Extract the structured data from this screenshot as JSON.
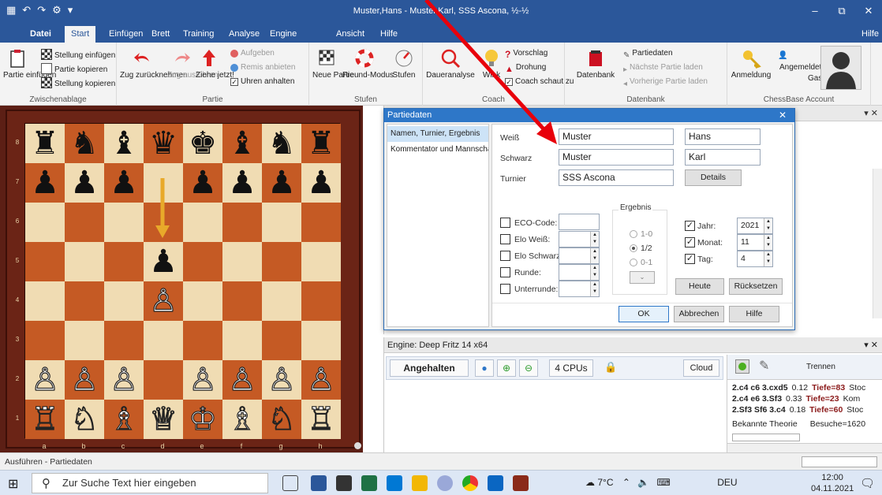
{
  "window": {
    "title": "Muster,Hans - Muster,Karl, SSS Ascona, ½-½",
    "controls": [
      "–",
      "⧉",
      "✕"
    ]
  },
  "ribbon": {
    "tabs": [
      "Datei",
      "Start",
      "Einfügen",
      "Brett",
      "Training",
      "Analyse",
      "Engine",
      "Ansicht",
      "Hilfe"
    ],
    "active_tab": "Start",
    "help_link": "Hilfe",
    "groups": {
      "clipboard": {
        "label": "Zwischenablage",
        "paste_game": "Partie einfügen",
        "paste_position": "Stellung einfügen",
        "copy_game": "Partie kopieren",
        "copy_position": "Stellung kopieren"
      },
      "game": {
        "label": "Partie",
        "take_back": "Zug zurücknehmen",
        "replay": "Zug ausführen",
        "move_now": "Ziehe jetzt!",
        "resign": "Aufgeben",
        "offer_draw": "Remis anbieten",
        "stop_clocks": "Uhren anhalten"
      },
      "levels": {
        "label": "Stufen",
        "new_game": "Neue Partie",
        "friend_mode": "Freund-Modus",
        "levels": "Stufen"
      },
      "coach": {
        "label": "Coach",
        "infinite_analysis": "Daueranalyse",
        "hint": "Wink",
        "suggestion": "Vorschlag",
        "threat": "Drohung",
        "coach_watches": "Coach schaut zu"
      },
      "database": {
        "label": "Datenbank",
        "database": "Datenbank",
        "game_data": "Partiedaten",
        "next_game": "Nächste Partie laden",
        "prev_game": "Vorherige Partie laden"
      },
      "account": {
        "label": "ChessBase Account",
        "login": "Anmeldung",
        "logged_in": "Angemeldet",
        "guest": "Gast"
      }
    }
  },
  "board": {
    "files": [
      "a",
      "b",
      "c",
      "d",
      "e",
      "f",
      "g",
      "h"
    ],
    "ranks": [
      "8",
      "7",
      "6",
      "5",
      "4",
      "3",
      "2",
      "1"
    ],
    "position": [
      [
        "♜",
        "♞",
        "♝",
        "♛",
        "♚",
        "♝",
        "♞",
        "♜"
      ],
      [
        "♟",
        "♟",
        "♟",
        "",
        "♟",
        "♟",
        "♟",
        "♟"
      ],
      [
        "",
        "",
        "",
        "",
        "",
        "",
        "",
        ""
      ],
      [
        "",
        "",
        "",
        "♟",
        "",
        "",
        "",
        ""
      ],
      [
        "",
        "",
        "",
        "♙",
        "",
        "",
        "",
        ""
      ],
      [
        "",
        "",
        "",
        "",
        "",
        "",
        "",
        ""
      ],
      [
        "♙",
        "♙",
        "♙",
        "",
        "♙",
        "♙",
        "♙",
        "♙"
      ],
      [
        "♖",
        "♘",
        "♗",
        "♕",
        "♔",
        "♗",
        "♘",
        "♖"
      ]
    ],
    "last_move_arrow": "d7-d5",
    "arrow_color": "#e8a92a"
  },
  "dialog": {
    "title": "Partiedaten",
    "close": "✕",
    "nav": [
      "Namen, Turnier, Ergebnis",
      "Kommentator und Mannscha..."
    ],
    "labels": {
      "white": "Weiß",
      "black": "Schwarz",
      "tournament": "Turnier",
      "eco": "ECO-Code:",
      "elo_white": "Elo Weiß:",
      "elo_black": "Elo Schwarz:",
      "round": "Runde:",
      "subround": "Unterrunde:",
      "result": "Ergebnis",
      "year": "Jahr:",
      "month": "Monat:",
      "day": "Tag:"
    },
    "values": {
      "white_last": "Muster",
      "white_first": "Hans",
      "black_last": "Muster",
      "black_first": "Karl",
      "tournament": "SSS Ascona",
      "year": "2021",
      "month": "11",
      "day": "4"
    },
    "result_options": [
      "1-0",
      "1/2",
      "0-1"
    ],
    "selected_result": "1/2",
    "buttons": {
      "details": "Details",
      "today": "Heute",
      "reset": "Rücksetzen",
      "ok": "OK",
      "cancel": "Abbrechen",
      "help": "Hilfe"
    }
  },
  "engine": {
    "title": "Engine: Deep Fritz 14 x64",
    "status": "Angehalten",
    "cpus": "4 CPUs",
    "cloud": "Cloud",
    "disconnect": "Trennen",
    "lines": [
      {
        "moves": "2.c4 c6 3.cxd5",
        "eval": "0.12",
        "depth": "Tiefe=83",
        "src": "Stoc"
      },
      {
        "moves": "2.c4 e6 3.Sf3",
        "eval": "0.33",
        "depth": "Tiefe=23",
        "src": "Kom"
      },
      {
        "moves": "2.Sf3 Sf6 3.c4",
        "eval": "0.18",
        "depth": "Tiefe=60",
        "src": "Stoc"
      }
    ],
    "theory": "Bekannte Theorie",
    "visits": "Besuche=1620"
  },
  "statusbar": {
    "text": "Ausführen - Partiedaten"
  },
  "taskbar": {
    "search_placeholder": "Zur Suche Text hier eingeben",
    "temperature": "7°C",
    "language": "DEU",
    "time": "12:00",
    "date": "04.11.2021"
  },
  "colors": {
    "ribbon_blue": "#2b579a",
    "board_dark": "#c55a24",
    "board_light": "#f0dcb3",
    "annotation_red": "#e8000b"
  }
}
